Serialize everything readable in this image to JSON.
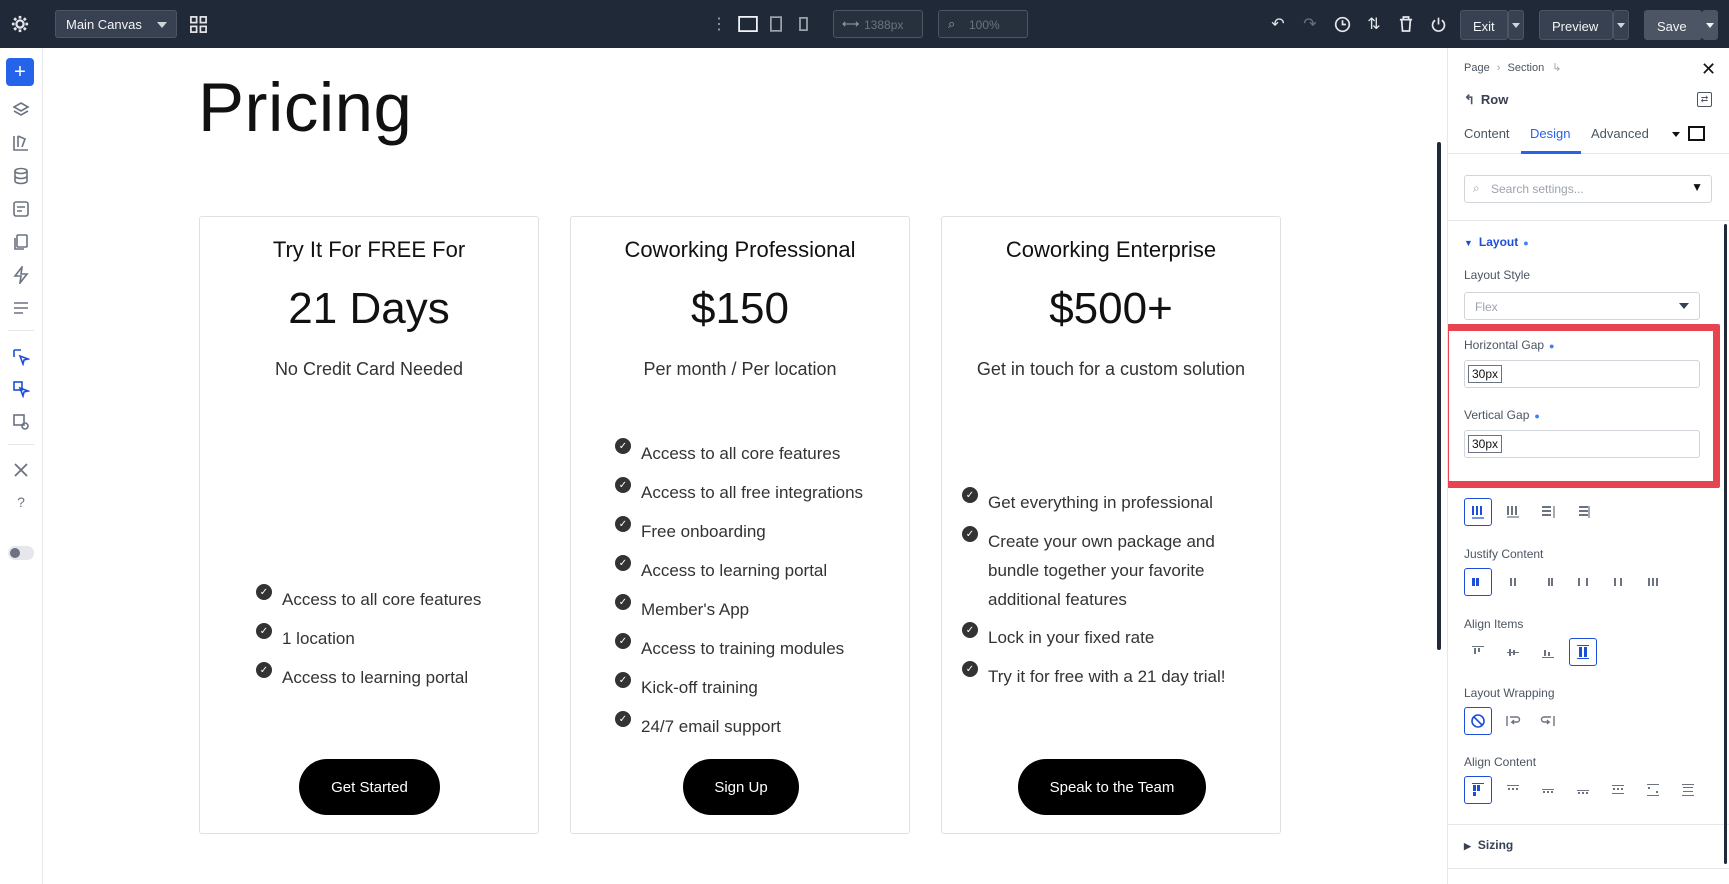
{
  "topbar": {
    "canvas_select": "Main Canvas",
    "width_value": "1388px",
    "zoom_value": "100%",
    "exit_label": "Exit",
    "preview_label": "Preview",
    "save_label": "Save"
  },
  "page": {
    "title": "Pricing",
    "cards": [
      {
        "heading": "Try It For FREE For",
        "price": "21 Days",
        "subtitle": "No Credit Card Needed",
        "features": [
          "Access to all core features",
          "1 location",
          "Access to learning portal"
        ],
        "cta": "Get Started"
      },
      {
        "heading": "Coworking Professional",
        "price": "$150",
        "subtitle": "Per month / Per location",
        "features": [
          "Access to all core features",
          "Access to all free integrations",
          "Free onboarding",
          "Access to learning portal",
          "Member's App",
          "Access to training modules",
          "Kick-off training",
          "24/7 email support"
        ],
        "cta": "Sign Up"
      },
      {
        "heading": "Coworking Enterprise",
        "price": "$500+",
        "subtitle": "Get in touch for a custom solution",
        "features": [
          "Get everything in professional",
          "Create your own package and bundle together your favorite additional features",
          "Lock in your fixed rate",
          "Try it for free with a 21 day trial!"
        ],
        "cta": "Speak to the Team"
      }
    ]
  },
  "panel": {
    "breadcrumb": [
      "Page",
      "Section"
    ],
    "element_title": "Row",
    "tabs": [
      "Content",
      "Design",
      "Advanced"
    ],
    "search_placeholder": "Search settings...",
    "layout_section": "Layout",
    "layout_style_label": "Layout Style",
    "layout_style_value": "Flex",
    "horizontal_gap_label": "Horizontal Gap",
    "horizontal_gap_value": "30px",
    "vertical_gap_label": "Vertical Gap",
    "vertical_gap_value": "30px",
    "justify_content_label": "Justify Content",
    "align_items_label": "Align Items",
    "layout_wrapping_label": "Layout Wrapping",
    "align_content_label": "Align Content",
    "sizing_section": "Sizing"
  },
  "colors": {
    "topbar_bg": "#1f2937",
    "accent": "#2563eb",
    "highlight": "#e64451",
    "button_bg": "#000000"
  }
}
